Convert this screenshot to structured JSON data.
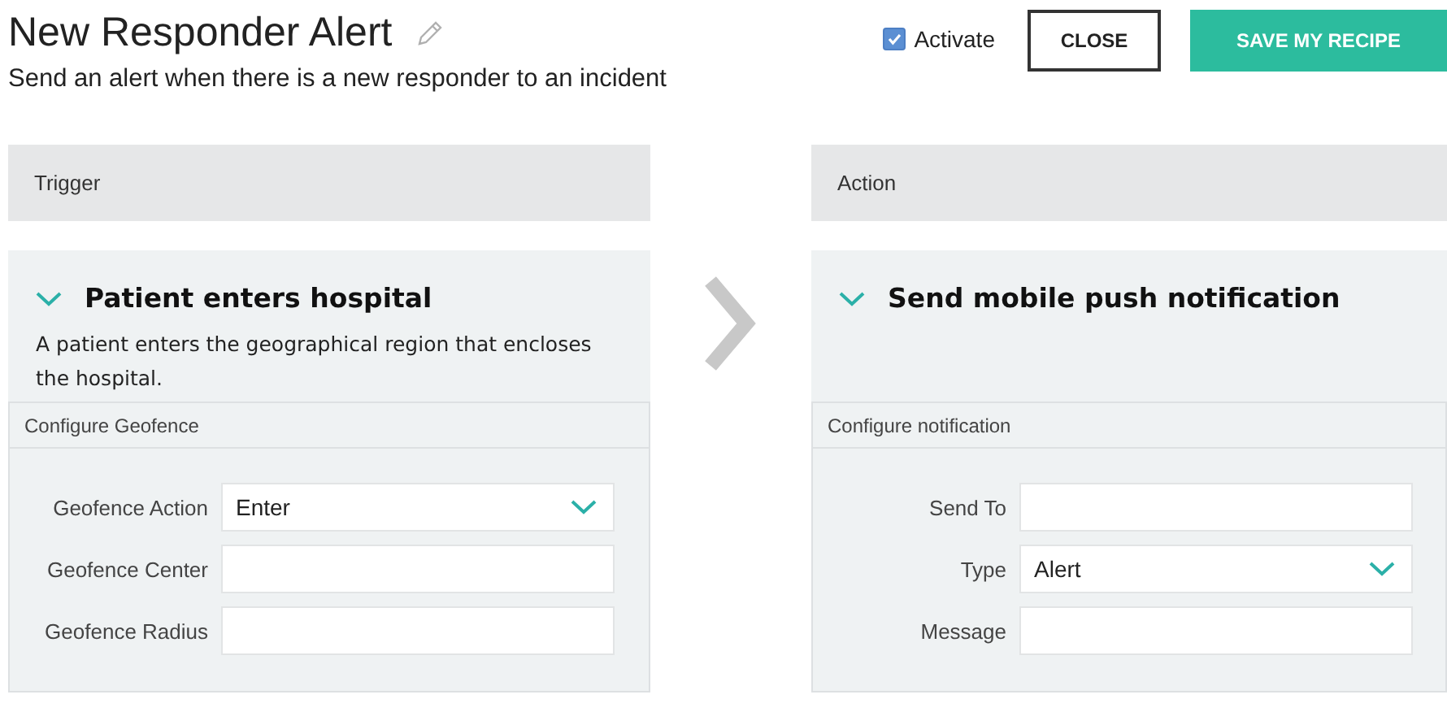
{
  "header": {
    "title": "New Responder Alert",
    "subtitle": "Send an alert when there is a new responder to an incident",
    "activate": {
      "label": "Activate",
      "checked": true
    },
    "buttons": [
      {
        "label": "CLOSE",
        "kind": "secondary"
      },
      {
        "label": "SAVE MY RECIPE",
        "kind": "primary"
      }
    ]
  },
  "panels": [
    {
      "heading": "Trigger",
      "card": {
        "title": "Patient enters hospital",
        "expanded": true,
        "description": "A patient enters the geographical region that encloses the hospital.",
        "section": "Configure Geofence",
        "fields": [
          {
            "label": "Geofence Action",
            "kind": "select",
            "value": "Enter"
          },
          {
            "label": "Geofence Center",
            "kind": "text"
          },
          {
            "label": "Geofence Radius",
            "kind": "text"
          }
        ]
      }
    },
    {
      "heading": "Action",
      "card": {
        "title": "Send mobile push notification",
        "expanded": true,
        "section": "Configure notification",
        "fields": [
          {
            "label": "Send To",
            "kind": "text"
          },
          {
            "label": "Type",
            "kind": "select",
            "value": "Alert"
          },
          {
            "label": "Message",
            "kind": "text"
          }
        ]
      }
    }
  ]
}
